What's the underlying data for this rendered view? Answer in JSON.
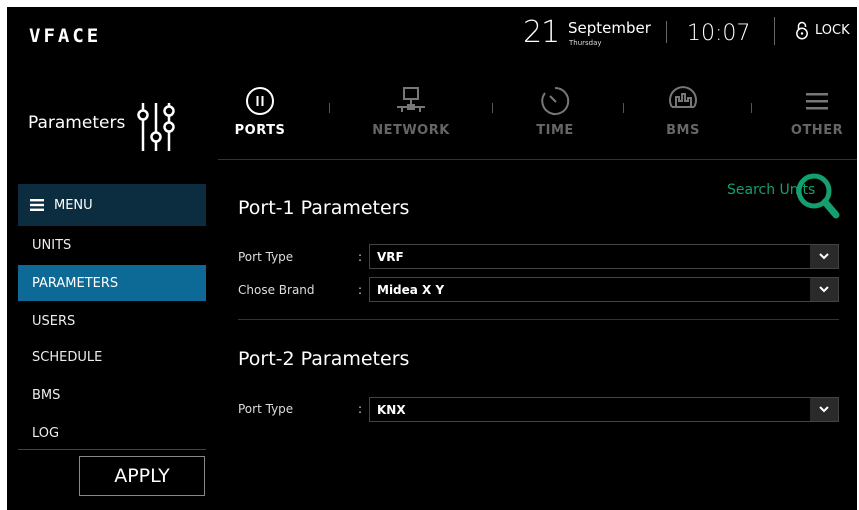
{
  "header": {
    "logo": "VFACE",
    "date_day": "21",
    "date_month": "September",
    "date_weekday": "Thursday",
    "time": "10:07",
    "lock_label": "LOCK"
  },
  "sidebar": {
    "title": "Parameters",
    "menu_label": "MENU",
    "items": [
      {
        "label": "UNITS",
        "active": false
      },
      {
        "label": "PARAMETERS",
        "active": true
      },
      {
        "label": "USERS",
        "active": false
      },
      {
        "label": "SCHEDULE",
        "active": false
      },
      {
        "label": "BMS",
        "active": false
      },
      {
        "label": "LOG",
        "active": false
      }
    ],
    "apply_label": "APPLY"
  },
  "tabs": [
    {
      "label": "PORTS",
      "icon": "pause-circle-icon",
      "active": true
    },
    {
      "label": "NETWORK",
      "icon": "network-icon",
      "active": false
    },
    {
      "label": "TIME",
      "icon": "timer-icon",
      "active": false
    },
    {
      "label": "BMS",
      "icon": "bms-icon",
      "active": false
    },
    {
      "label": "OTHER",
      "icon": "hamburger-icon",
      "active": false
    }
  ],
  "content": {
    "search_units_label": "Search Units",
    "port1": {
      "title": "Port-1 Parameters",
      "fields": [
        {
          "label": "Port Type",
          "value": "VRF"
        },
        {
          "label": "Chose Brand",
          "value": "Midea X Y"
        }
      ]
    },
    "port2": {
      "title": "Port-2 Parameters",
      "fields": [
        {
          "label": "Port Type",
          "value": "KNX"
        }
      ]
    }
  },
  "colors": {
    "accent_active": "#0d6a96",
    "menu_header": "#0c2d40",
    "search_green": "#13a06e"
  }
}
